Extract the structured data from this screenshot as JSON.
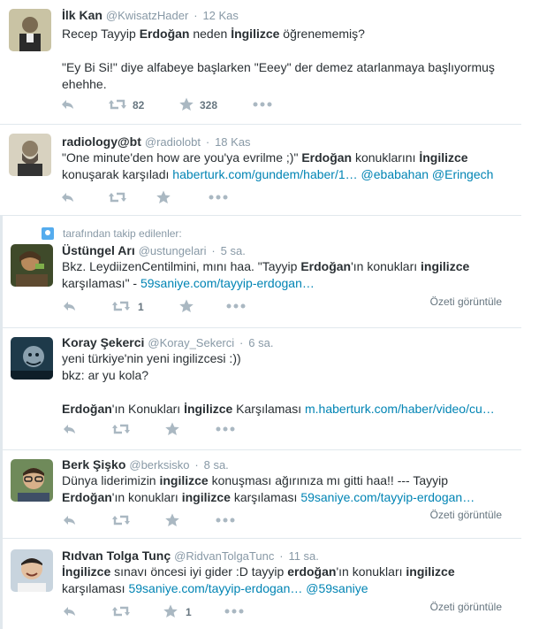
{
  "tweets": [
    {
      "fullname": "İlk Kan",
      "username": "@KwisatzHader",
      "sep": "·",
      "time": "12 Kas",
      "retweets": "82",
      "favorites": "328"
    },
    {
      "fullname": "radiology@bt",
      "username": "@radiolobt",
      "sep": "·",
      "time": "18 Kas",
      "retweets": "",
      "favorites": ""
    },
    {
      "fullname": "Üstüngel Arı",
      "username": "@ustungelari",
      "sep": "·",
      "time": "5 sa.",
      "retweets": "1",
      "favorites": "",
      "summary": "Özeti görüntüle"
    },
    {
      "fullname": "Koray Şekerci",
      "username": "@Koray_Sekerci",
      "sep": "·",
      "time": "6 sa.",
      "retweets": "",
      "favorites": ""
    },
    {
      "fullname": "Berk Şişko",
      "username": "@berksisko",
      "sep": "·",
      "time": "8 sa.",
      "retweets": "",
      "favorites": "",
      "summary": "Özeti görüntüle"
    },
    {
      "fullname": "Rıdvan Tolga Tunç",
      "username": "@RidvanTolgaTunc",
      "sep": "·",
      "time": "11 sa.",
      "retweets": "",
      "favorites": "1",
      "summary": "Özeti görüntüle"
    }
  ],
  "context_label": "tarafından takip edilenler:",
  "text": {
    "t1_a": "Recep Tayyip ",
    "t1_b": "Erdoğan",
    "t1_c": " neden ",
    "t1_d": "İngilizce",
    "t1_e": " öğrenememiş?",
    "t1_l3": "\"Ey Bi Si!\" diye alfabeye başlarken \"Eeey\" der demez atarlanmaya başlıyormuş",
    "t1_l4": "ehehhe.",
    "t2_a": "\"One minute'den how are you'ya evrilme ;)\" ",
    "t2_b": "Erdoğan",
    "t2_c": " konuklarını ",
    "t2_d": "İngilizce",
    "t2_e": "konuşarak karşıladı ",
    "t2_link": "haberturk.com/gundem/haber/1…",
    "t2_m1": " @ebabahan",
    "t2_m2": " @Eringech",
    "t3_a": "Bkz. LeydiizenCentilmini, mını haa. \"Tayyip ",
    "t3_b": "Erdoğan",
    "t3_c": "'ın konukları ",
    "t3_d": "ingilizce",
    "t3_e": "karşılaması\" - ",
    "t3_link": "59saniye.com/tayyip-erdogan…",
    "t4_l1": "yeni türkiye'nin yeni ingilizcesi :))",
    "t4_l2": "bkz: ar yu kola?",
    "t4_a": "Erdoğan",
    "t4_b": "'ın Konukları ",
    "t4_c": "İngilizce",
    "t4_d": " Karşılaması ",
    "t4_link": "m.haberturk.com/haber/video/cu…",
    "t5_a": "Dünya liderimizin ",
    "t5_b": "ingilizce",
    "t5_c": " konuşması ağırınıza mı gitti haa!! --- Tayyip",
    "t5_d": "Erdoğan",
    "t5_e": "'ın konukları ",
    "t5_f": "ingilizce",
    "t5_g": " karşılaması ",
    "t5_link": "59saniye.com/tayyip-erdogan…",
    "t6_a": "İngilizce",
    "t6_b": " sınavı öncesi iyi gider :D  tayyip ",
    "t6_c": "erdoğan",
    "t6_d": "'ın konukları ",
    "t6_e": "ingilizce",
    "t6_f": "karşılaması ",
    "t6_link": "59saniye.com/tayyip-erdogan…",
    "t6_m": " @59saniye"
  },
  "icons": {
    "reply": "reply-icon",
    "retweet": "retweet-icon",
    "favorite": "star-icon",
    "more": "more-icon",
    "context": "follow-context-icon"
  },
  "colors": {
    "link": "#0084b4",
    "muted": "#8899a6",
    "action": "#aab8c2",
    "divider": "#e1e8ed",
    "context_icon": "#55acee"
  }
}
